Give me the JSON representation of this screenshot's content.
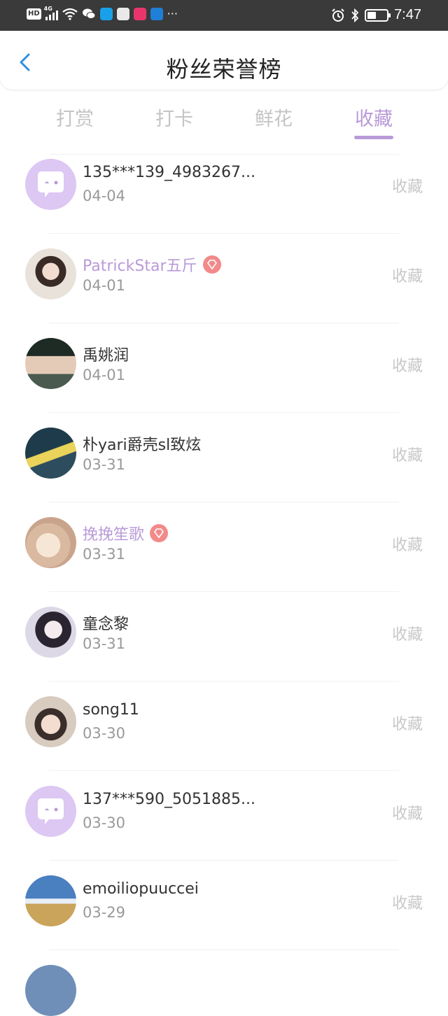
{
  "status_bar": {
    "hd": "HD",
    "network": "4G",
    "time": "7:47",
    "more": "···"
  },
  "header": {
    "title": "粉丝荣誉榜"
  },
  "tabs": [
    {
      "label": "打赏",
      "active": false
    },
    {
      "label": "打卡",
      "active": false
    },
    {
      "label": "鲜花",
      "active": false
    },
    {
      "label": "收藏",
      "active": true
    }
  ],
  "fans": [
    {
      "name": "135***139_4983267...",
      "date": "04-04",
      "action": "收藏",
      "vip": false,
      "avatar": "chat-bubble-avatar"
    },
    {
      "name": "PatrickStar五斤",
      "date": "04-01",
      "action": "收藏",
      "vip": true,
      "avatar": "girl-photo-avatar"
    },
    {
      "name": "禹姚润",
      "date": "04-01",
      "action": "收藏",
      "vip": false,
      "avatar": "hat-boy-avatar"
    },
    {
      "name": "朴yari爵壳sl致炫",
      "date": "03-31",
      "action": "收藏",
      "vip": false,
      "avatar": "sneaker-photo-avatar"
    },
    {
      "name": "挽挽笙歌",
      "date": "03-31",
      "action": "收藏",
      "vip": true,
      "avatar": "plush-toy-avatar"
    },
    {
      "name": "童念黎",
      "date": "03-31",
      "action": "收藏",
      "vip": false,
      "avatar": "anime-girl-avatar"
    },
    {
      "name": "song11",
      "date": "03-30",
      "action": "收藏",
      "vip": false,
      "avatar": "selfie-avatar"
    },
    {
      "name": "137***590_5051885...",
      "date": "03-30",
      "action": "收藏",
      "vip": false,
      "avatar": "chat-bubble-avatar"
    },
    {
      "name": "emoiliopuuccei",
      "date": "03-29",
      "action": "收藏",
      "vip": false,
      "avatar": "landscape-avatar"
    }
  ],
  "colors": {
    "accent": "#b99ad8",
    "back_arrow": "#2f8fe0",
    "vip_badge": "#f28a8a",
    "bubble_bg": "#ddc7f3"
  }
}
